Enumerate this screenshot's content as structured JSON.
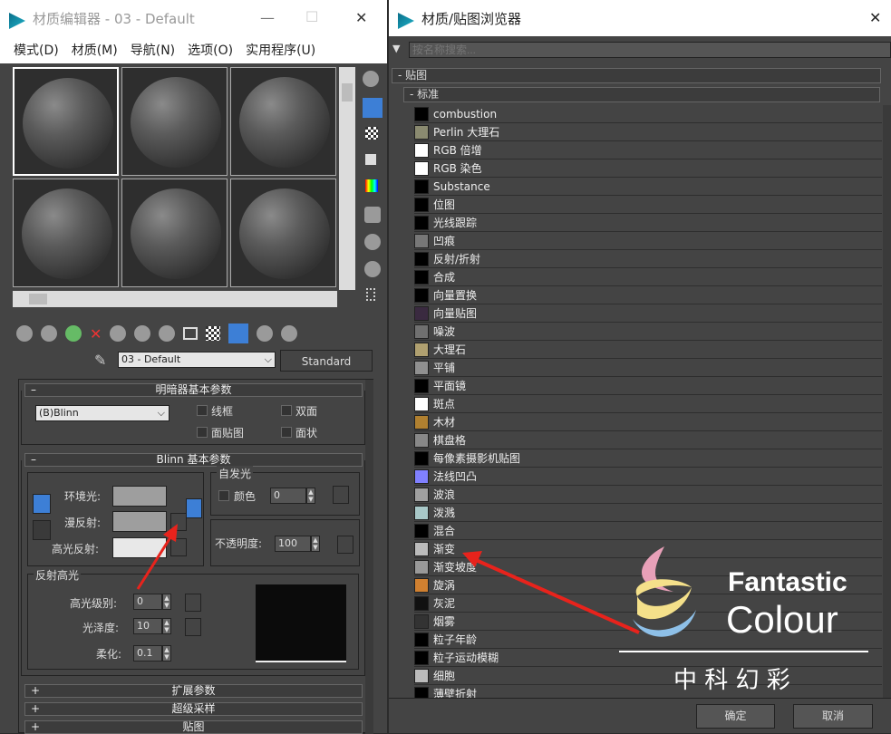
{
  "left_window": {
    "title": "材质编辑器 - 03 - Default",
    "controls": [
      "—",
      "☐",
      "✕"
    ],
    "menu": [
      "模式(D)",
      "材质(M)",
      "导航(N)",
      "选项(O)",
      "实用程序(U)"
    ],
    "material_name": "03 - Default",
    "material_type": "Standard",
    "shader_rollout": {
      "title": "明暗器基本参数",
      "sign": "–",
      "shader": "(B)Blinn",
      "options": [
        "线框",
        "双面",
        "面贴图",
        "面状"
      ]
    },
    "blinn_rollout": {
      "title": "Blinn 基本参数",
      "sign": "–",
      "ambient": "环境光:",
      "diffuse": "漫反射:",
      "specular": "高光反射:",
      "self_illum": {
        "title": "自发光",
        "color_label": "颜色",
        "value": "0"
      },
      "opacity": {
        "label": "不透明度:",
        "value": "100"
      },
      "spec_highlights": {
        "title": "反射高光",
        "level_label": "高光级别:",
        "level": "0",
        "gloss_label": "光泽度:",
        "gloss": "10",
        "soften_label": "柔化:",
        "soften": "0.1"
      }
    },
    "collapsed_rollouts": [
      {
        "sign": "+",
        "title": "扩展参数"
      },
      {
        "sign": "+",
        "title": "超级采样"
      },
      {
        "sign": "+",
        "title": "贴图"
      }
    ]
  },
  "right_window": {
    "title": "材质/贴图浏览器",
    "close": "✕",
    "search_placeholder": "按名称搜索...",
    "group": "- 贴图",
    "subgroup": "- 标准",
    "items": [
      {
        "label": "combustion",
        "swatch": "#000000"
      },
      {
        "label": "Perlin 大理石",
        "swatch": "#8a8a70"
      },
      {
        "label": "RGB 倍增",
        "swatch": "#ffffff"
      },
      {
        "label": "RGB 染色",
        "swatch": "#ffffff"
      },
      {
        "label": "Substance",
        "swatch": "#000000"
      },
      {
        "label": "位图",
        "swatch": "#000000"
      },
      {
        "label": "光线跟踪",
        "swatch": "#000000"
      },
      {
        "label": "凹痕",
        "swatch": "#777777"
      },
      {
        "label": "反射/折射",
        "swatch": "#000000"
      },
      {
        "label": "合成",
        "swatch": "#000000"
      },
      {
        "label": "向量置换",
        "swatch": "#000000"
      },
      {
        "label": "向量贴图",
        "swatch": "#3a2a40"
      },
      {
        "label": "噪波",
        "swatch": "#707070"
      },
      {
        "label": "大理石",
        "swatch": "#b0a070"
      },
      {
        "label": "平铺",
        "swatch": "#909090"
      },
      {
        "label": "平面镜",
        "swatch": "#000000"
      },
      {
        "label": "斑点",
        "swatch": "#ffffff"
      },
      {
        "label": "木材",
        "swatch": "#b08030"
      },
      {
        "label": "棋盘格",
        "swatch": "#888888"
      },
      {
        "label": "每像素摄影机贴图",
        "swatch": "#000000"
      },
      {
        "label": "法线凹凸",
        "swatch": "#8080ff"
      },
      {
        "label": "波浪",
        "swatch": "#a0a0a0"
      },
      {
        "label": "泼溅",
        "swatch": "#a8c8c8"
      },
      {
        "label": "混合",
        "swatch": "#000000"
      },
      {
        "label": "渐变",
        "swatch": "#bbbbbb"
      },
      {
        "label": "渐变坡度",
        "swatch": "#999999"
      },
      {
        "label": "旋涡",
        "swatch": "#d08030"
      },
      {
        "label": "灰泥",
        "swatch": "#111111"
      },
      {
        "label": "烟雾",
        "swatch": "#333333"
      },
      {
        "label": "粒子年龄",
        "swatch": "#000000"
      },
      {
        "label": "粒子运动模糊",
        "swatch": "#000000"
      },
      {
        "label": "细胞",
        "swatch": "#bbbbbb"
      },
      {
        "label": "薄壁折射",
        "swatch": "#000000"
      }
    ],
    "ok": "确定",
    "cancel": "取消"
  },
  "watermark": {
    "line1": "Fantastic",
    "line2": "Colour",
    "cn": "中 科 幻 彩"
  },
  "colors": {
    "accent": "#3d7fd6",
    "arrow": "#e8231c"
  }
}
